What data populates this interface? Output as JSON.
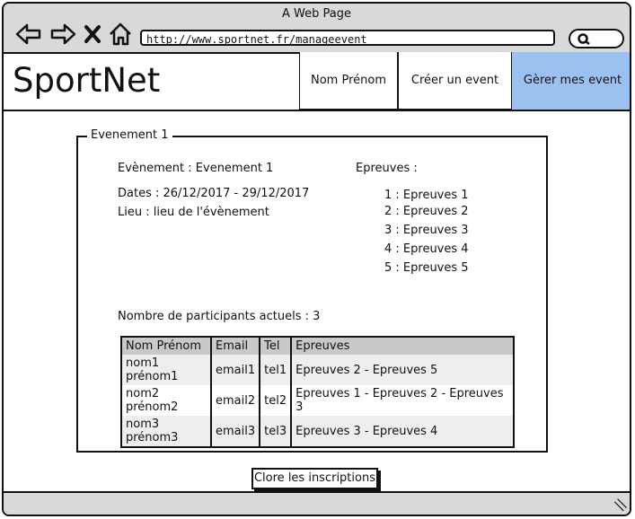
{
  "window": {
    "title": "A Web Page",
    "url": "http://www.sportnet.fr/manageevent"
  },
  "header": {
    "logo": "SportNet",
    "nav": [
      "Nom Prénom",
      "Créer un event",
      "Gèrer mes event"
    ]
  },
  "event": {
    "legend": "Evenement 1",
    "name_line": "Evènement : Evenement 1",
    "dates_line": "Dates : 26/12/2017 - 29/12/2017",
    "lieu_line": "Lieu : lieu de l'évènement",
    "epreuves_title": "Epreuves :",
    "epreuves": [
      "1 : Epreuves 1",
      "2 : Epreuves 2",
      "3 : Epreuves 3",
      "4 : Epreuves 4",
      "5 : Epreuves 5"
    ],
    "participants_line": "Nombre de participants actuels : 3"
  },
  "table": {
    "headers": [
      "Nom Prénom",
      "Email",
      "Tel",
      "Epreuves"
    ],
    "rows": [
      [
        "nom1 prénom1",
        "email1",
        "tel1",
        "Epreuves 2 - Epreuves 5"
      ],
      [
        "nom2 prénom2",
        "email2",
        "tel2",
        "Epreuves 1 - Epreuves 2 - Epreuves 3"
      ],
      [
        "nom3 prénom3",
        "email3",
        "tel3",
        "Epreuves 3 - Epreuves 4"
      ]
    ]
  },
  "actions": {
    "close_label": "Clore les inscriptions"
  },
  "colors": {
    "active_nav": "#9cc1f0",
    "chrome": "#d9d9d9"
  }
}
